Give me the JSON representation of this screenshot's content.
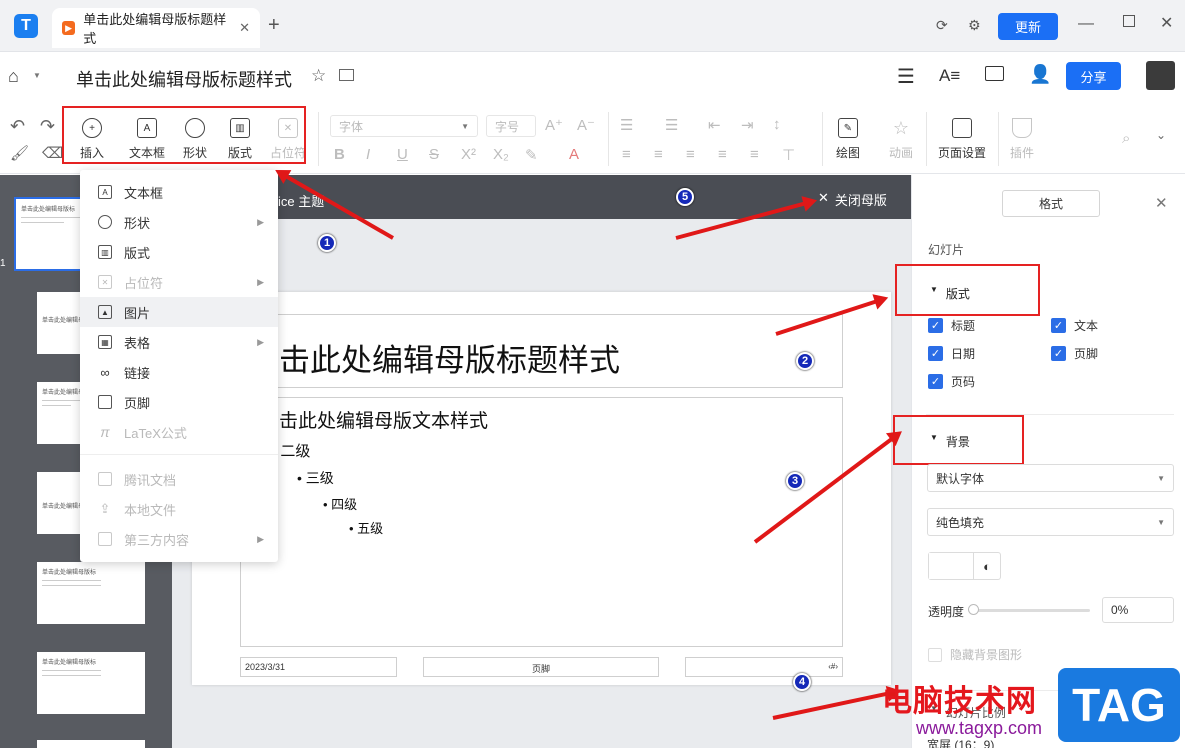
{
  "window": {
    "tab_title": "单击此处编辑母版标题样式",
    "update_label": "更新"
  },
  "header": {
    "doc_title": "单击此处编辑母版标题样式",
    "share_label": "分享"
  },
  "ribbon": {
    "insert": "插入",
    "textbox": "文本框",
    "shape": "形状",
    "layout": "版式",
    "placeholder": "占位符",
    "font_placeholder": "字体",
    "size_placeholder": "字号",
    "draw": "绘图",
    "animation": "动画",
    "page_setup": "页面设置",
    "plugin": "插件"
  },
  "menu": {
    "items": [
      {
        "label": "文本框",
        "icon": "textbox-icon"
      },
      {
        "label": "形状",
        "icon": "shape-icon"
      },
      {
        "label": "版式",
        "icon": "layout-icon"
      },
      {
        "label": "占位符",
        "icon": "placeholder-icon"
      },
      {
        "label": "图片",
        "icon": "image-icon"
      },
      {
        "label": "表格",
        "icon": "table-icon"
      },
      {
        "label": "链接",
        "icon": "link-icon"
      },
      {
        "label": "页脚",
        "icon": "footer-icon"
      },
      {
        "label": "LaTeX公式",
        "icon": "formula-icon"
      },
      {
        "label": "腾讯文档",
        "icon": "tencent-docs-icon"
      },
      {
        "label": "本地文件",
        "icon": "upload-icon"
      },
      {
        "label": "第三方内容",
        "icon": "puzzle-icon"
      }
    ]
  },
  "master": {
    "theme_label": "ice 主题",
    "close_label": "关闭母版"
  },
  "slide": {
    "title": "击此处编辑母版标题样式",
    "body": "击此处编辑母版文本样式",
    "level2": "二级",
    "level3": "三级",
    "level4": "四级",
    "level5": "五级",
    "date": "2023/3/31",
    "footer": "页脚",
    "page_num": "‹#›"
  },
  "thumbnails": {
    "slide_number": "1",
    "thumb_title": "单击此处编辑母版标"
  },
  "panel": {
    "format_button": "格式",
    "slide_label": "幻灯片",
    "layout_header": "版式",
    "checkboxes": [
      "标题",
      "文本",
      "日期",
      "页脚",
      "页码"
    ],
    "background_header": "背景",
    "font_select": "默认字体",
    "fill_select": "纯色填充",
    "opacity_label": "透明度",
    "opacity_value": "0%",
    "hide_bg": "隐藏背景图形",
    "ratio_label": "幻灯片比例",
    "ratio_value": "宽屏 (16：9)"
  },
  "annotations": [
    "1",
    "2",
    "3",
    "4",
    "5"
  ],
  "watermark": {
    "text": "电脑技术网",
    "url": "www.tagxp.com",
    "tag": "TAG"
  },
  "colors": {
    "accent": "#1b6ff5",
    "annotation_red": "#e52222",
    "badge_blue": "#1529b8"
  }
}
